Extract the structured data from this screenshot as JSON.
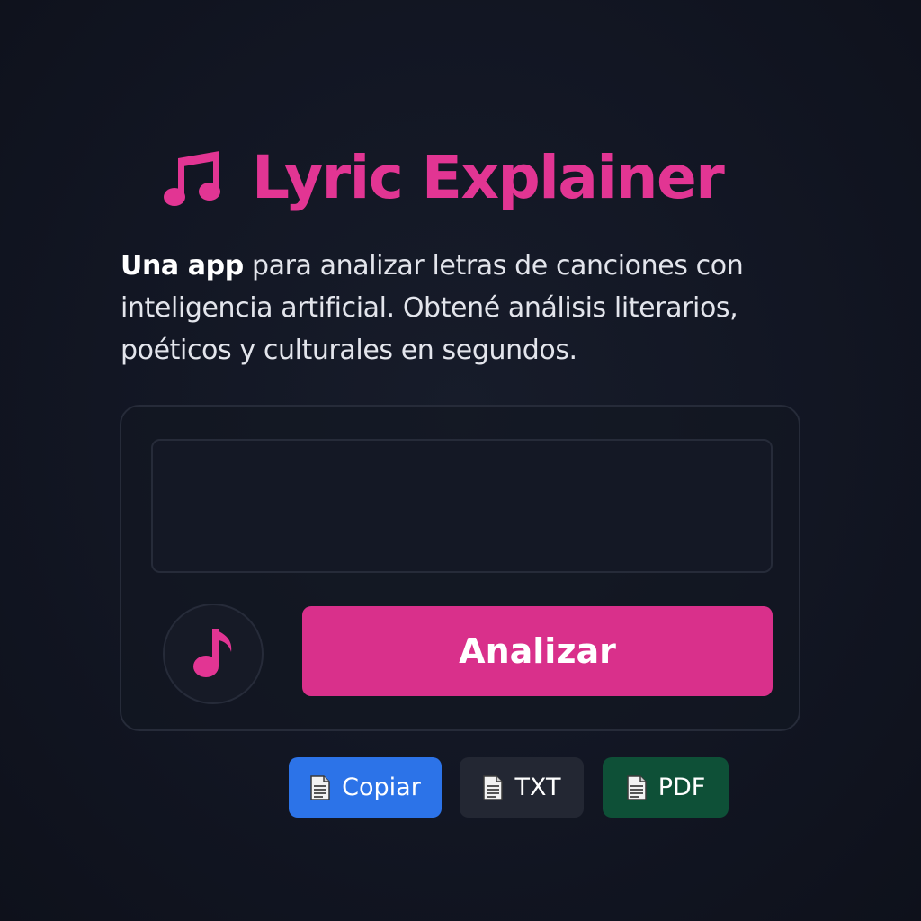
{
  "header": {
    "title": "Lyric Explainer",
    "title_icon": "music-notes-icon",
    "accent_color": "#e23593"
  },
  "description": {
    "bold_lead": "Una app",
    "text": " para analizar letras de canciones con inteligencia artificial. Obtené análisis literarios, poéticos y culturales en segundos."
  },
  "form": {
    "lyrics_input": {
      "value": "",
      "placeholder": ""
    },
    "music_button_icon": "music-note-icon",
    "analyze_label": "Analizar",
    "analyze_color": "#d9308b"
  },
  "export": {
    "copy": {
      "label": "Copiar",
      "icon": "document-icon",
      "color": "#2c73e8"
    },
    "txt": {
      "label": "TXT",
      "icon": "document-icon",
      "color": "#232733"
    },
    "pdf": {
      "label": "PDF",
      "icon": "document-icon",
      "color": "#0e5037"
    }
  }
}
